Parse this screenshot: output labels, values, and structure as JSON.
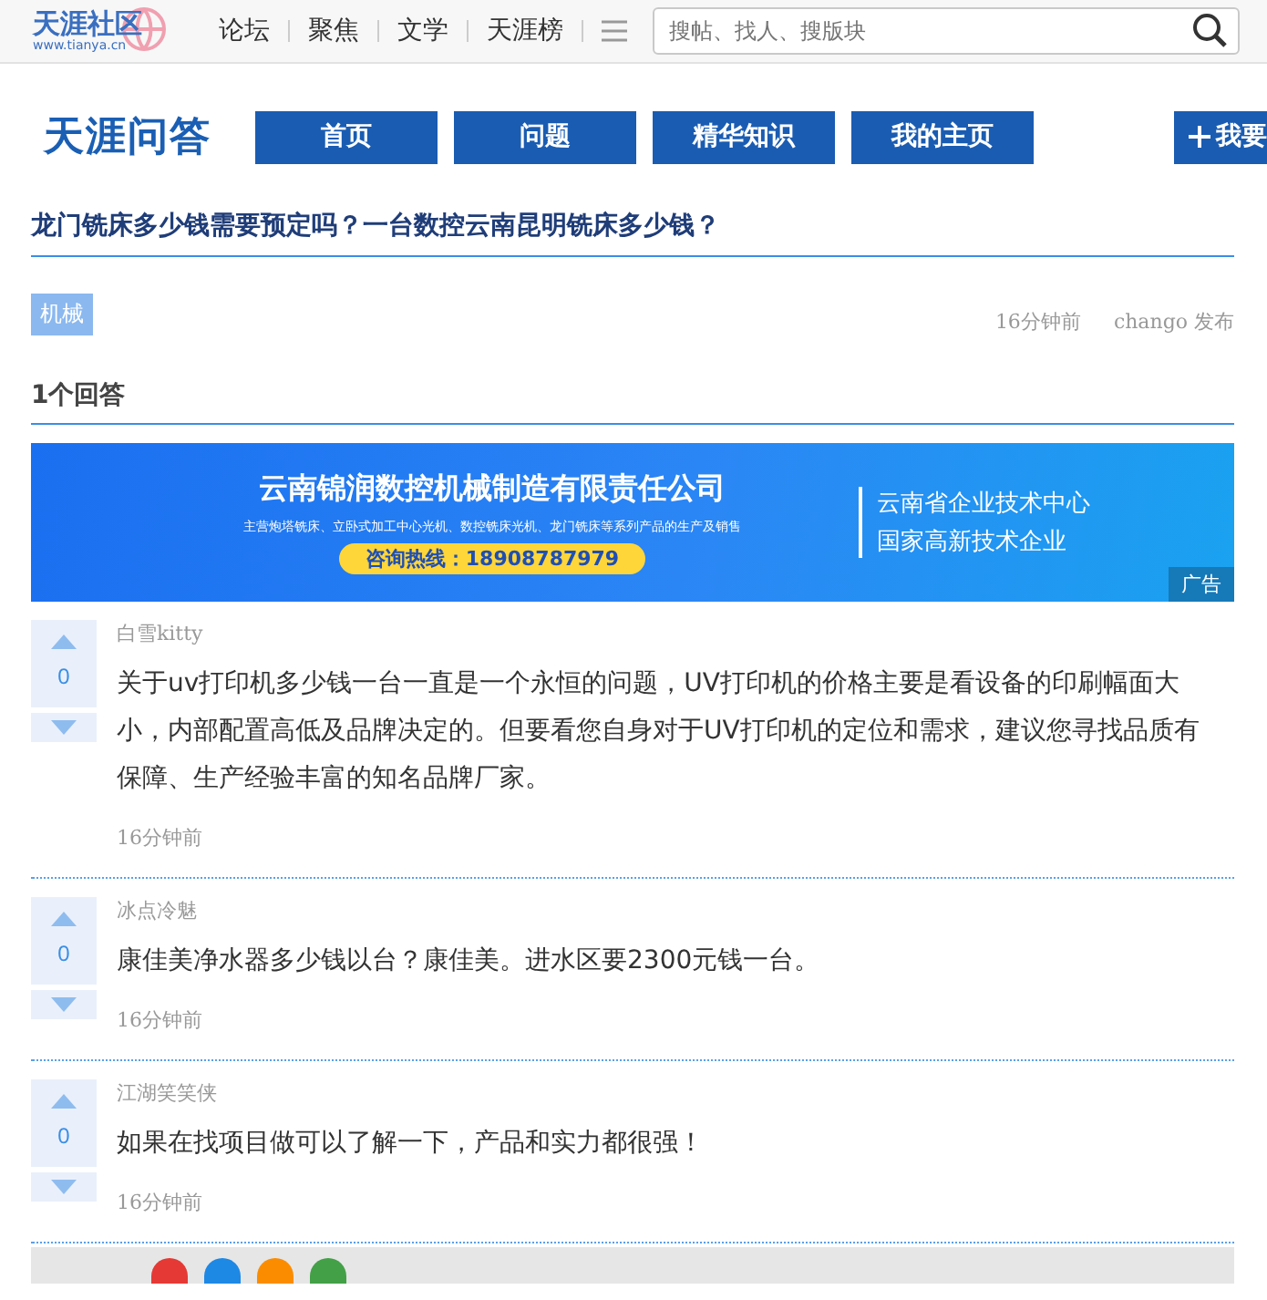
{
  "header": {
    "logo": {
      "title": "天涯社区",
      "url": "www.tianya.cn"
    },
    "nav": [
      "论坛",
      "聚焦",
      "文学",
      "天涯榜"
    ],
    "search": {
      "placeholder": "搜帖、找人、搜版块"
    }
  },
  "subnav": {
    "logo": "天涯问答",
    "items": [
      "首页",
      "问题",
      "精华知识",
      "我的主页"
    ],
    "ask_button": "我要"
  },
  "question": {
    "title": "龙门铣床多少钱需要预定吗？一台数控云南昆明铣床多少钱？",
    "tag": "机械",
    "time": "16分钟前",
    "author": "chango 发布"
  },
  "answers_heading": "1个回答",
  "banner": {
    "company": "云南锦润数控机械制造有限责任公司",
    "tagline": "主营炮塔铣床、立卧式加工中心光机、数控铣床光机、龙门铣床等系列产品的生产及销售",
    "hotline": "咨询热线：18908787979",
    "badges": [
      "云南省企业技术中心",
      "国家高新技术企业"
    ],
    "ad_label": "广告"
  },
  "answers": [
    {
      "author": "白雪kitty",
      "votes": "0",
      "text": "关于uv打印机多少钱一台一直是一个永恒的问题，UV打印机的价格主要是看设备的印刷幅面大小，内部配置高低及品牌决定的。但要看您自身对于UV打印机的定位和需求，建议您寻找品质有保障、生产经验丰富的知名品牌厂家。",
      "time": "16分钟前"
    },
    {
      "author": "冰点冷魅",
      "votes": "0",
      "text": "康佳美净水器多少钱以台？康佳美。进水区要2300元钱一台。",
      "time": "16分钟前"
    },
    {
      "author": "江湖笑笑侠",
      "votes": "0",
      "text": "如果在找项目做可以了解一下，产品和实力都很强！",
      "time": "16分钟前"
    }
  ],
  "share_bar": {
    "icons": [
      {
        "color": "#e53935"
      },
      {
        "color": "#1e88e5"
      },
      {
        "color": "#fb8c00"
      },
      {
        "color": "#43a047"
      }
    ]
  }
}
